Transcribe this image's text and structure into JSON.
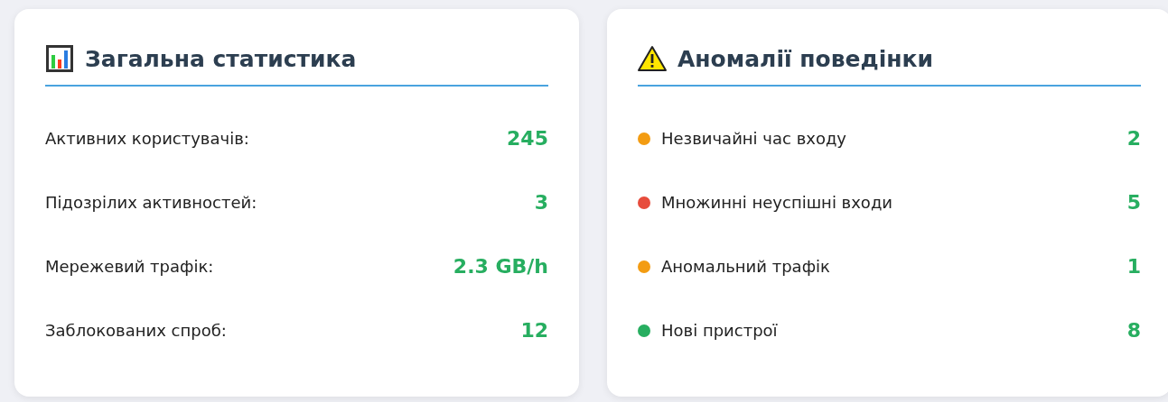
{
  "cards": [
    {
      "kind": "stats",
      "title": "Загальна статистика",
      "rows": [
        {
          "label": "Активних користувачів:",
          "value": "245"
        },
        {
          "label": "Підозрілих активностей:",
          "value": "3"
        },
        {
          "label": "Мережевий трафік:",
          "value": "2.3 GB/h"
        },
        {
          "label": "Заблокованих спроб:",
          "value": "12"
        }
      ]
    },
    {
      "kind": "anomalies",
      "title": "Аномалії поведінки",
      "rows": [
        {
          "label": "Незвичайні час входу",
          "value": "2",
          "color": "#f39c12"
        },
        {
          "label": "Множинні неуспішні входи",
          "value": "5",
          "color": "#e74c3c"
        },
        {
          "label": "Аномальний трафік",
          "value": "1",
          "color": "#f39c12"
        },
        {
          "label": "Нові пристрої",
          "value": "8",
          "color": "#27ae60"
        }
      ]
    }
  ]
}
